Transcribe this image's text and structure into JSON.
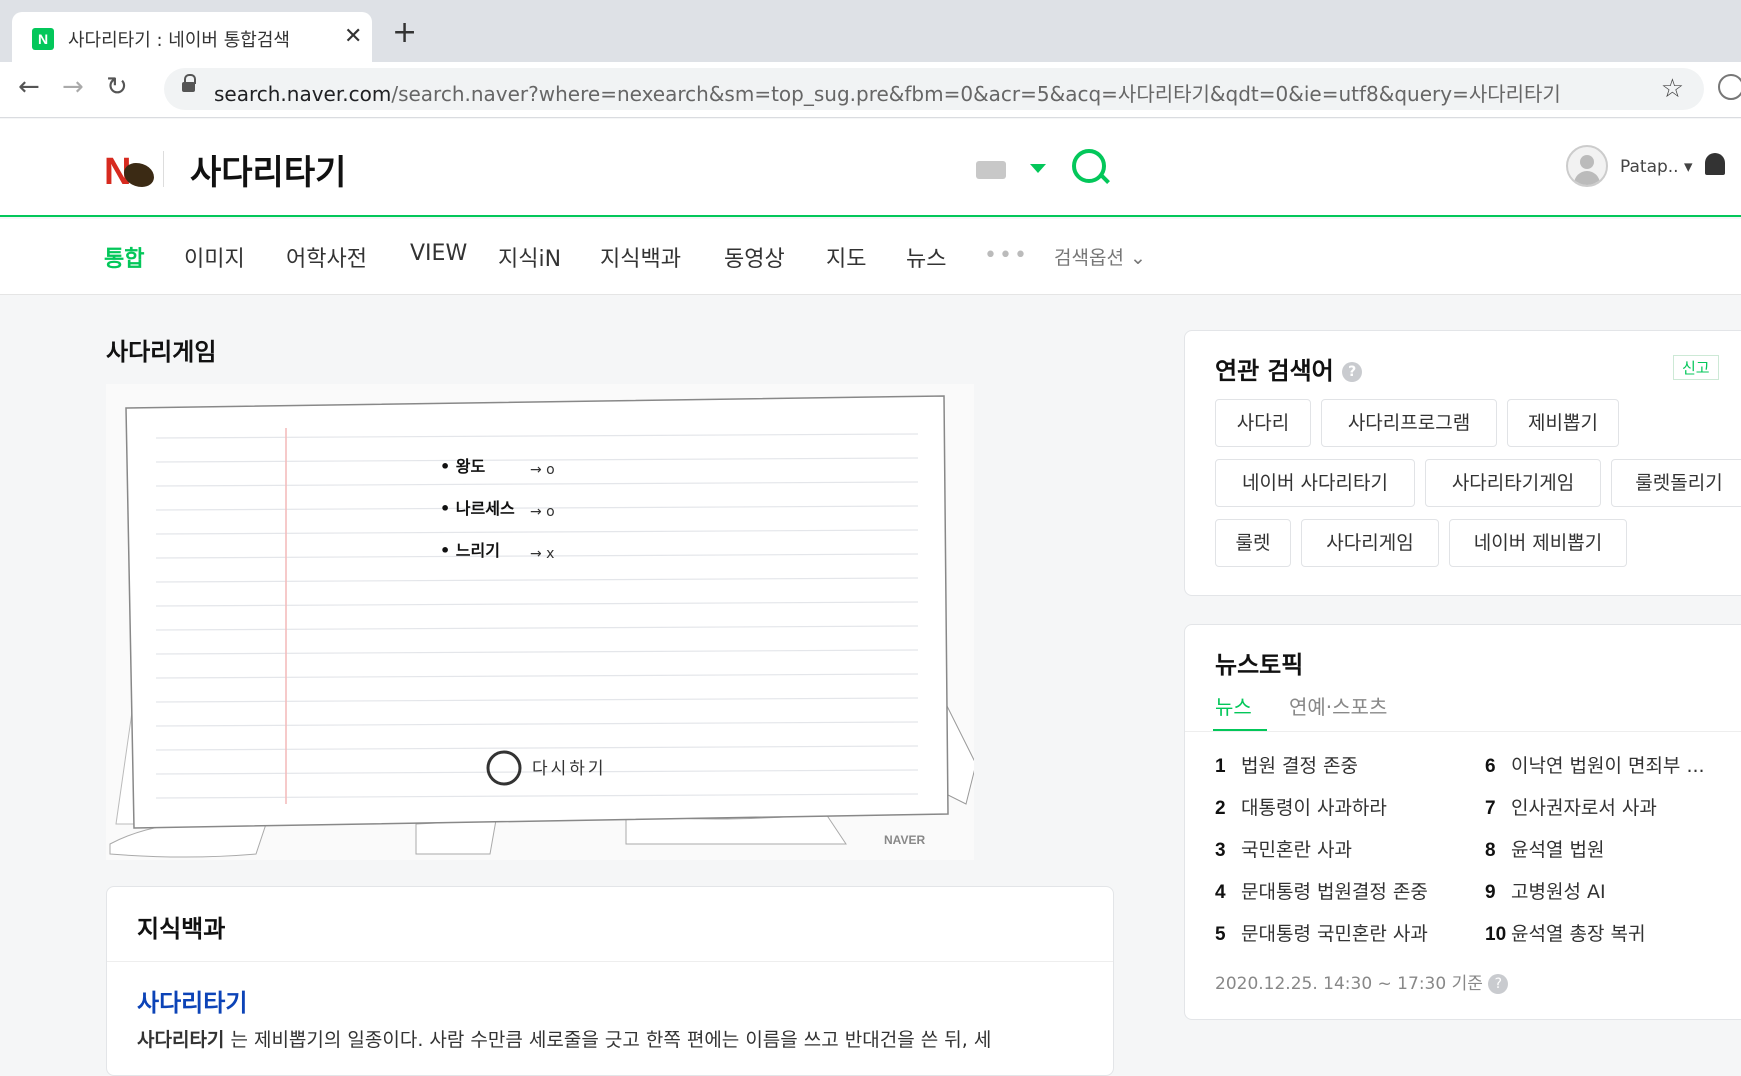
{
  "browser": {
    "tab_title": "사다리타기 : 네이버 통합검색",
    "favicon": "N",
    "url_host": "search.naver.com",
    "url_rest": "/search.naver?where=nexearch&sm=top_sug.pre&fbm=0&acr=5&acq=사다리타기&qdt=0&ie=utf8&query=사다리타기"
  },
  "header": {
    "logo": "N",
    "query": "사다리타기",
    "username": "Patap.. ▾"
  },
  "tabs": [
    "통합",
    "이미지",
    "어학사전",
    "VIEW",
    "지식iN",
    "지식백과",
    "동영상",
    "지도",
    "뉴스"
  ],
  "more_dots": "•••",
  "search_options": "검색옵션 ⌄",
  "ladder_game": {
    "title": "사다리게임",
    "items": [
      {
        "name": "• 왕도",
        "result": "→ o"
      },
      {
        "name": "• 나르세스",
        "result": "→ o"
      },
      {
        "name": "• 느리기",
        "result": "→ x"
      }
    ],
    "retry": "다시하기",
    "watermark": "NAVER"
  },
  "encyclopedia": {
    "title": "지식백과",
    "entry_title": "사다리타기",
    "entry_bold": "사다리타기",
    "entry_text": " 는 제비뽑기의 일종이다. 사람 수만큼 세로줄을 긋고 한쪽 편에는 이름을 쓰고 반대건을 쓴 뒤, 세"
  },
  "related": {
    "title": "연관 검색어",
    "help": "?",
    "report": "신고",
    "chips": [
      "사다리",
      "사다리프로그램",
      "제비뽑기",
      "네이버 사다리타기",
      "사다리타기게임",
      "룰렛돌리기",
      "룰렛",
      "사다리게임",
      "네이버 제비뽑기"
    ]
  },
  "news_topic": {
    "title": "뉴스토픽",
    "tab_news": "뉴스",
    "tab_ent": "연예·스포츠",
    "left": [
      {
        "rank": "1",
        "text": "법원 결정 존중"
      },
      {
        "rank": "2",
        "text": "대통령이 사과하라"
      },
      {
        "rank": "3",
        "text": "국민혼란 사과"
      },
      {
        "rank": "4",
        "text": "문대통령 법원결정 존중"
      },
      {
        "rank": "5",
        "text": "문대통령 국민혼란 사과"
      }
    ],
    "right": [
      {
        "rank": "6",
        "text": "이낙연 법원이 면죄부 ..."
      },
      {
        "rank": "7",
        "text": "인사권자로서 사과"
      },
      {
        "rank": "8",
        "text": "윤석열 법원"
      },
      {
        "rank": "9",
        "text": "고병원성 AI"
      },
      {
        "rank": "10",
        "text": "윤석열 총장 복귀"
      }
    ],
    "timestamp": "2020.12.25. 14:30 ~ 17:30 기준",
    "help": "?"
  },
  "colors": {
    "accent": "#03c75a",
    "link": "#0c43b7"
  }
}
